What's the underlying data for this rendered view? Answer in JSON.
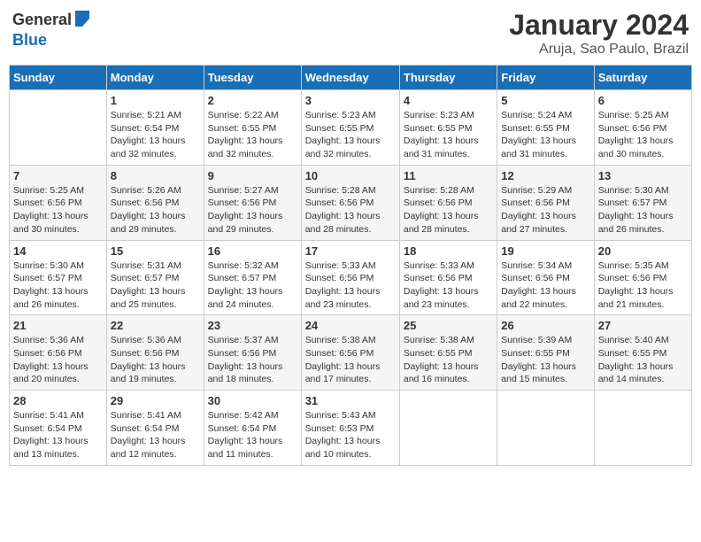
{
  "app": {
    "logo_general": "General",
    "logo_blue": "Blue"
  },
  "title": "January 2024",
  "subtitle": "Aruja, Sao Paulo, Brazil",
  "weekdays": [
    "Sunday",
    "Monday",
    "Tuesday",
    "Wednesday",
    "Thursday",
    "Friday",
    "Saturday"
  ],
  "weeks": [
    [
      {
        "day": "",
        "info": ""
      },
      {
        "day": "1",
        "info": "Sunrise: 5:21 AM\nSunset: 6:54 PM\nDaylight: 13 hours\nand 32 minutes."
      },
      {
        "day": "2",
        "info": "Sunrise: 5:22 AM\nSunset: 6:55 PM\nDaylight: 13 hours\nand 32 minutes."
      },
      {
        "day": "3",
        "info": "Sunrise: 5:23 AM\nSunset: 6:55 PM\nDaylight: 13 hours\nand 32 minutes."
      },
      {
        "day": "4",
        "info": "Sunrise: 5:23 AM\nSunset: 6:55 PM\nDaylight: 13 hours\nand 31 minutes."
      },
      {
        "day": "5",
        "info": "Sunrise: 5:24 AM\nSunset: 6:55 PM\nDaylight: 13 hours\nand 31 minutes."
      },
      {
        "day": "6",
        "info": "Sunrise: 5:25 AM\nSunset: 6:56 PM\nDaylight: 13 hours\nand 30 minutes."
      }
    ],
    [
      {
        "day": "7",
        "info": "Sunrise: 5:25 AM\nSunset: 6:56 PM\nDaylight: 13 hours\nand 30 minutes."
      },
      {
        "day": "8",
        "info": "Sunrise: 5:26 AM\nSunset: 6:56 PM\nDaylight: 13 hours\nand 29 minutes."
      },
      {
        "day": "9",
        "info": "Sunrise: 5:27 AM\nSunset: 6:56 PM\nDaylight: 13 hours\nand 29 minutes."
      },
      {
        "day": "10",
        "info": "Sunrise: 5:28 AM\nSunset: 6:56 PM\nDaylight: 13 hours\nand 28 minutes."
      },
      {
        "day": "11",
        "info": "Sunrise: 5:28 AM\nSunset: 6:56 PM\nDaylight: 13 hours\nand 28 minutes."
      },
      {
        "day": "12",
        "info": "Sunrise: 5:29 AM\nSunset: 6:56 PM\nDaylight: 13 hours\nand 27 minutes."
      },
      {
        "day": "13",
        "info": "Sunrise: 5:30 AM\nSunset: 6:57 PM\nDaylight: 13 hours\nand 26 minutes."
      }
    ],
    [
      {
        "day": "14",
        "info": "Sunrise: 5:30 AM\nSunset: 6:57 PM\nDaylight: 13 hours\nand 26 minutes."
      },
      {
        "day": "15",
        "info": "Sunrise: 5:31 AM\nSunset: 6:57 PM\nDaylight: 13 hours\nand 25 minutes."
      },
      {
        "day": "16",
        "info": "Sunrise: 5:32 AM\nSunset: 6:57 PM\nDaylight: 13 hours\nand 24 minutes."
      },
      {
        "day": "17",
        "info": "Sunrise: 5:33 AM\nSunset: 6:56 PM\nDaylight: 13 hours\nand 23 minutes."
      },
      {
        "day": "18",
        "info": "Sunrise: 5:33 AM\nSunset: 6:56 PM\nDaylight: 13 hours\nand 23 minutes."
      },
      {
        "day": "19",
        "info": "Sunrise: 5:34 AM\nSunset: 6:56 PM\nDaylight: 13 hours\nand 22 minutes."
      },
      {
        "day": "20",
        "info": "Sunrise: 5:35 AM\nSunset: 6:56 PM\nDaylight: 13 hours\nand 21 minutes."
      }
    ],
    [
      {
        "day": "21",
        "info": "Sunrise: 5:36 AM\nSunset: 6:56 PM\nDaylight: 13 hours\nand 20 minutes."
      },
      {
        "day": "22",
        "info": "Sunrise: 5:36 AM\nSunset: 6:56 PM\nDaylight: 13 hours\nand 19 minutes."
      },
      {
        "day": "23",
        "info": "Sunrise: 5:37 AM\nSunset: 6:56 PM\nDaylight: 13 hours\nand 18 minutes."
      },
      {
        "day": "24",
        "info": "Sunrise: 5:38 AM\nSunset: 6:56 PM\nDaylight: 13 hours\nand 17 minutes."
      },
      {
        "day": "25",
        "info": "Sunrise: 5:38 AM\nSunset: 6:55 PM\nDaylight: 13 hours\nand 16 minutes."
      },
      {
        "day": "26",
        "info": "Sunrise: 5:39 AM\nSunset: 6:55 PM\nDaylight: 13 hours\nand 15 minutes."
      },
      {
        "day": "27",
        "info": "Sunrise: 5:40 AM\nSunset: 6:55 PM\nDaylight: 13 hours\nand 14 minutes."
      }
    ],
    [
      {
        "day": "28",
        "info": "Sunrise: 5:41 AM\nSunset: 6:54 PM\nDaylight: 13 hours\nand 13 minutes."
      },
      {
        "day": "29",
        "info": "Sunrise: 5:41 AM\nSunset: 6:54 PM\nDaylight: 13 hours\nand 12 minutes."
      },
      {
        "day": "30",
        "info": "Sunrise: 5:42 AM\nSunset: 6:54 PM\nDaylight: 13 hours\nand 11 minutes."
      },
      {
        "day": "31",
        "info": "Sunrise: 5:43 AM\nSunset: 6:53 PM\nDaylight: 13 hours\nand 10 minutes."
      },
      {
        "day": "",
        "info": ""
      },
      {
        "day": "",
        "info": ""
      },
      {
        "day": "",
        "info": ""
      }
    ]
  ]
}
